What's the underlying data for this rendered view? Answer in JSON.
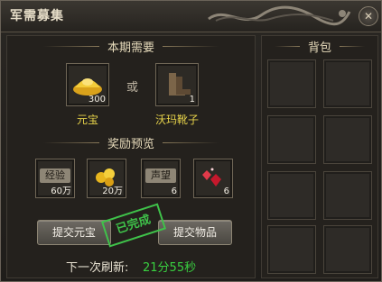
{
  "window": {
    "title": "军需募集",
    "close": "✕"
  },
  "requirements": {
    "title": "本期需要",
    "or_text": "或",
    "items": [
      {
        "name": "元宝",
        "qty": "300",
        "icon": "gold-ingot-icon"
      },
      {
        "name": "沃玛靴子",
        "qty": "1",
        "icon": "boots-icon"
      }
    ]
  },
  "rewards": {
    "title": "奖励预览",
    "items": [
      {
        "name": "经验",
        "qty": "60万",
        "icon": "experience-scroll-icon"
      },
      {
        "name": "",
        "qty": "20万",
        "icon": "gold-coins-icon"
      },
      {
        "name": "声望",
        "qty": "6",
        "icon": "reputation-scroll-icon"
      },
      {
        "name": "",
        "qty": "6",
        "icon": "red-gem-icon"
      }
    ]
  },
  "buttons": {
    "submit_gold": "提交元宝",
    "submit_item": "提交物品"
  },
  "stamp": "已完成",
  "refresh": {
    "label": "下一次刷新:",
    "time": "21分55秒"
  },
  "bag": {
    "title": "背包",
    "slot_count": 8
  },
  "colors": {
    "accent_yellow": "#e6d24a",
    "timer_green": "#39d040",
    "stamp_green": "#3fc24a"
  }
}
